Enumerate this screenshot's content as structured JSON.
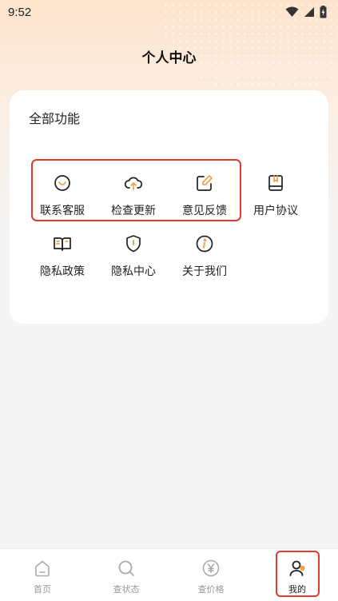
{
  "status_bar": {
    "time": "9:52"
  },
  "header": {
    "title": "个人中心"
  },
  "card": {
    "title": "全部功能",
    "items": [
      {
        "label": "联系客服",
        "icon": "customer-service-icon"
      },
      {
        "label": "检查更新",
        "icon": "cloud-upload-icon"
      },
      {
        "label": "意见反馈",
        "icon": "edit-icon"
      },
      {
        "label": "用户协议",
        "icon": "bookmark-book-icon"
      },
      {
        "label": "隐私政策",
        "icon": "open-book-icon"
      },
      {
        "label": "隐私中心",
        "icon": "shield-icon"
      },
      {
        "label": "关于我们",
        "icon": "info-icon"
      }
    ]
  },
  "bottom_nav": {
    "items": [
      {
        "label": "首页",
        "icon": "home-icon"
      },
      {
        "label": "查状态",
        "icon": "search-icon"
      },
      {
        "label": "查价格",
        "icon": "yen-icon"
      },
      {
        "label": "我的",
        "icon": "profile-icon"
      }
    ],
    "active_index": 3
  },
  "colors": {
    "accent": "#f0a24a",
    "highlight": "#e03b2d"
  }
}
